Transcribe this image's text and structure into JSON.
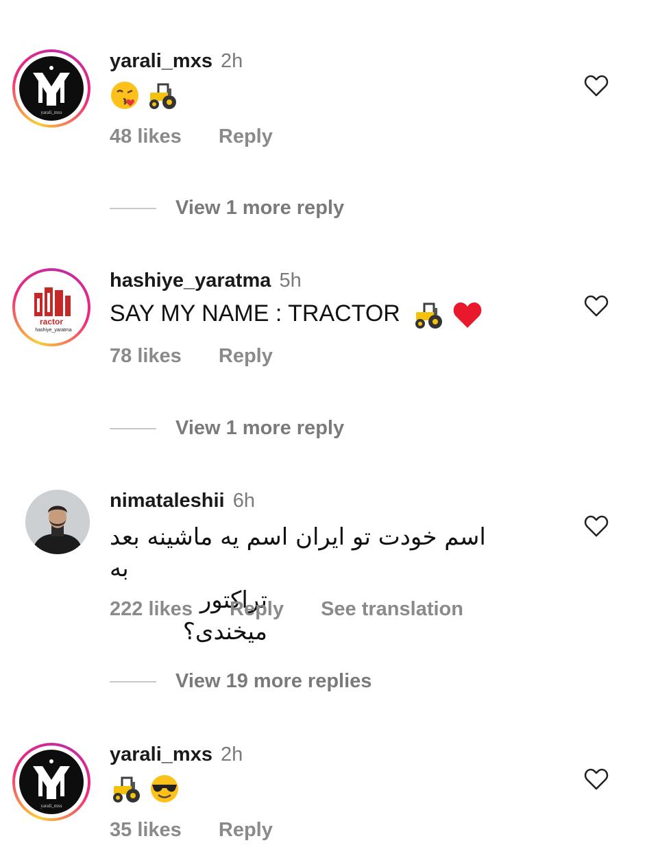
{
  "comments": [
    {
      "username": "yarali_mxs",
      "time": "2h",
      "likes": "48 likes",
      "reply": "Reply",
      "emojis": [
        "kissing-face-emoji",
        "tractor-emoji"
      ],
      "avatar_caption": "yarali_mxs",
      "view_more": "View 1 more reply"
    },
    {
      "username": "hashiye_yaratma",
      "time": "5h",
      "text": "SAY MY NAME : TRACTOR",
      "emojis": [
        "tractor-emoji",
        "red-heart-emoji"
      ],
      "likes": "78 likes",
      "reply": "Reply",
      "avatar_word": "ractor",
      "avatar_caption": "hashiye_yaratma",
      "view_more": "View 1 more reply"
    },
    {
      "username": "nimataleshii",
      "time": "6h",
      "text_line1": "اسم خودت تو ایران اسم یه ماشینه بعد به",
      "text_line2": "تراکتور میخندی؟",
      "likes": "222 likes",
      "reply": "Reply",
      "translate": "See translation",
      "view_more": "View 19 more replies"
    },
    {
      "username": "yarali_mxs",
      "time": "2h",
      "emojis": [
        "tractor-emoji",
        "sunglasses-face-emoji"
      ],
      "likes": "35 likes",
      "reply": "Reply",
      "avatar_caption": "yarali_mxs"
    }
  ],
  "colors": {
    "username": "#1a1a1a",
    "meta": "#8a8a8a",
    "divider": "#c7c7c7",
    "heart_outline": "#222222"
  }
}
